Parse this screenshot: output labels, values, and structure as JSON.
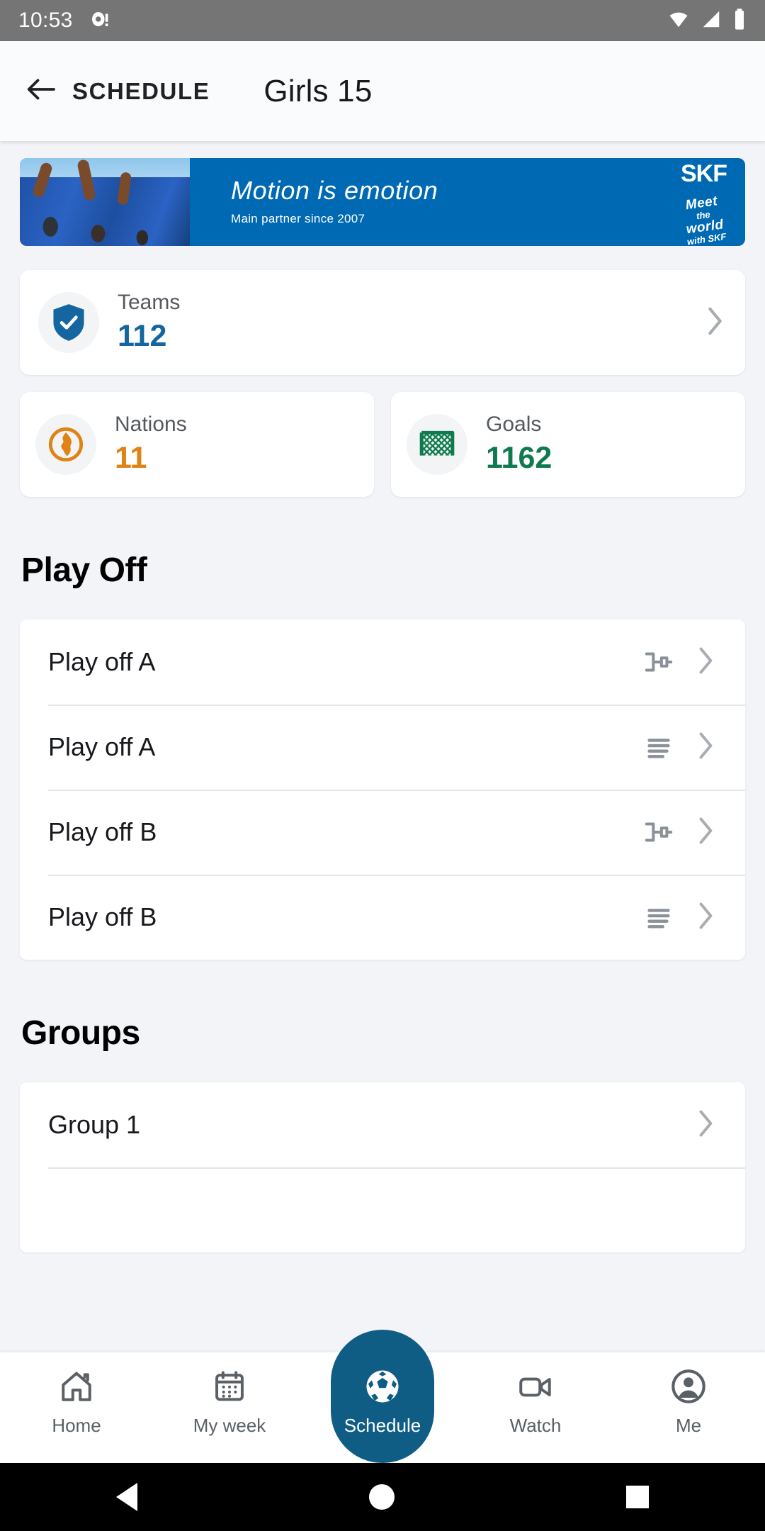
{
  "status_bar": {
    "time": "10:53",
    "icons": [
      "notification-icon",
      "wifi-icon",
      "signal-icon",
      "battery-icon"
    ]
  },
  "app_bar": {
    "back_label": "SCHEDULE",
    "title": "Girls 15"
  },
  "banner": {
    "tagline": "Motion is emotion",
    "subtitle": "Main partner since 2007",
    "brand": "SKF",
    "meet_line1": "Meet",
    "meet_the": "the",
    "meet_world": "world",
    "meet_line3": "with SKF",
    "bg_color": "#0069b4"
  },
  "stats": {
    "teams": {
      "label": "Teams",
      "value": "112",
      "color": "#1565a0",
      "icon": "shield-check-icon"
    },
    "nations": {
      "label": "Nations",
      "value": "11",
      "color": "#e08214",
      "icon": "globe-icon"
    },
    "goals": {
      "label": "Goals",
      "value": "1162",
      "color": "#0e7a4e",
      "icon": "goal-net-icon"
    }
  },
  "sections": [
    {
      "title": "Play Off",
      "rows": [
        {
          "label": "Play off A",
          "icon": "bracket-icon"
        },
        {
          "label": "Play off A",
          "icon": "standings-icon"
        },
        {
          "label": "Play off B",
          "icon": "bracket-icon"
        },
        {
          "label": "Play off B",
          "icon": "standings-icon"
        }
      ]
    },
    {
      "title": "Groups",
      "rows": [
        {
          "label": "Group 1",
          "icon": ""
        }
      ]
    }
  ],
  "bottom_nav": {
    "active_index": 2,
    "items": [
      {
        "label": "Home",
        "icon": "home-icon"
      },
      {
        "label": "My week",
        "icon": "calendar-icon"
      },
      {
        "label": "Schedule",
        "icon": "soccer-ball-icon"
      },
      {
        "label": "Watch",
        "icon": "video-camera-icon"
      },
      {
        "label": "Me",
        "icon": "person-icon"
      }
    ],
    "active_color": "#0f5d85"
  }
}
